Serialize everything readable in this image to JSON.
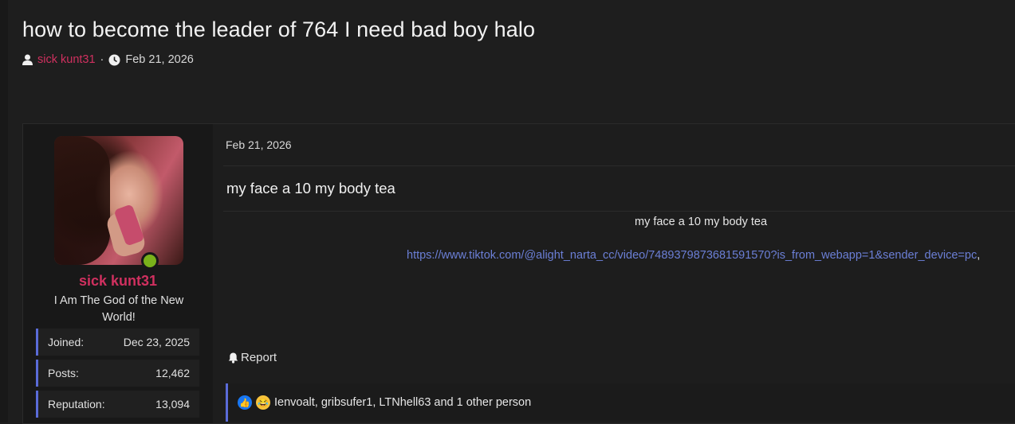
{
  "thread": {
    "title": "how to become the leader of 764 I need bad boy halo",
    "author": "sick kunt31",
    "separator": "·",
    "date": "Feb 21, 2026"
  },
  "user": {
    "name": "sick kunt31",
    "title": "I Am The God of the New World!",
    "stats": [
      {
        "label": "Joined:",
        "value": "Dec 23, 2025"
      },
      {
        "label": "Posts:",
        "value": "12,462"
      },
      {
        "label": "Reputation:",
        "value": "13,094"
      }
    ]
  },
  "post": {
    "date": "Feb 21, 2026",
    "heading": "my face a 10 my body tea",
    "body": "my face a 10 my body tea",
    "link": "https://www.tiktok.com/@alight_narta_cc/video/7489379873681591570?is_from_webapp=1&sender_device=pc",
    "link_suffix": ",",
    "report_label": "Report",
    "reactions_text": "Ienvoalt, gribsufer1, LTNhell63 and 1 other person"
  },
  "colors": {
    "accent": "#d0305f",
    "link": "#6b7fd6",
    "stat_border": "#5a6bd8",
    "online": "#7ab21b"
  },
  "icons": {
    "author": "user-icon",
    "date": "clock-icon",
    "report": "bell-icon",
    "reaction_like": "thumbs-up-icon",
    "reaction_laugh": "laugh-cry-icon"
  }
}
